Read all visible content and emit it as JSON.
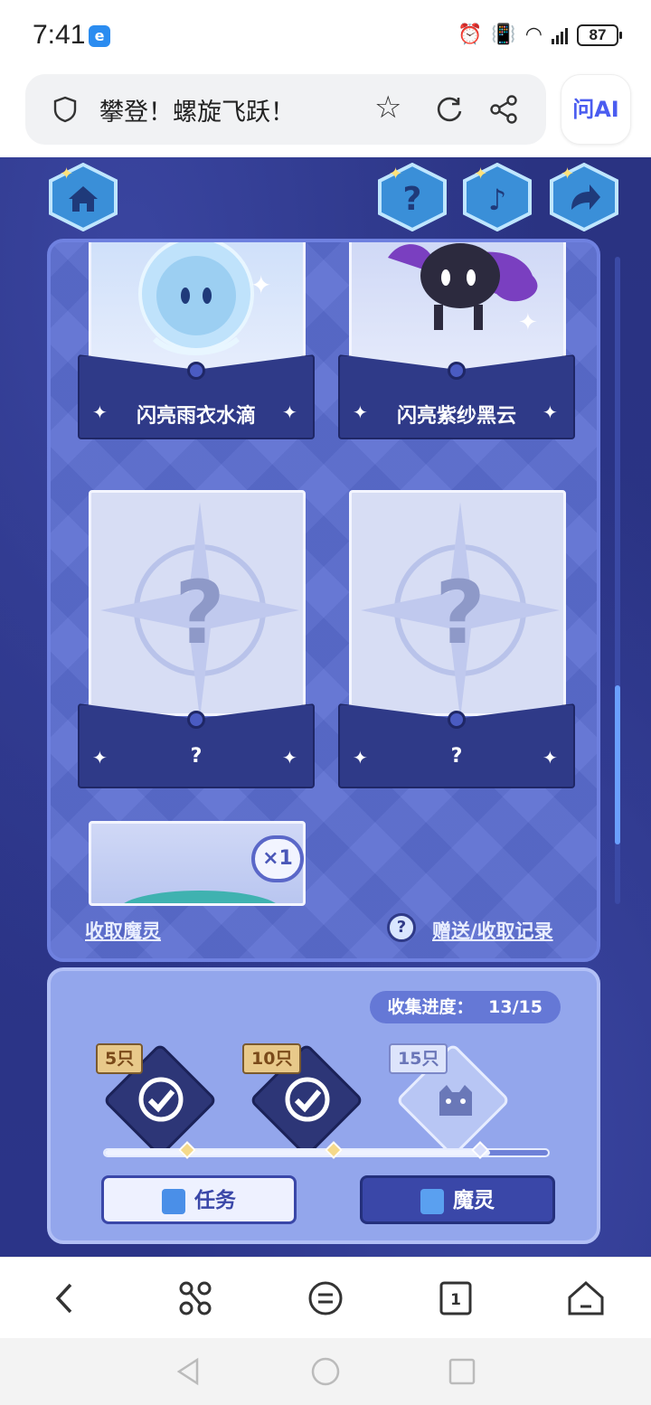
{
  "status_bar": {
    "time": "7:41",
    "battery": "87"
  },
  "browser": {
    "page_title": "攀登！螺旋飞跃！",
    "ai_button_label": "问AI"
  },
  "game": {
    "cards": [
      {
        "name": "闪亮雨衣水滴",
        "locked": false
      },
      {
        "name": "闪亮紫纱黑云",
        "locked": false
      },
      {
        "name": "?",
        "locked": true
      },
      {
        "name": "?",
        "locked": true
      }
    ],
    "partial_card_badge": "×1",
    "collect_link": "收取魔灵",
    "record_link": "赠送/收取记录",
    "progress_label": "收集进度：",
    "progress_value": "13/15",
    "milestones": [
      {
        "label": "5只",
        "achieved": true
      },
      {
        "label": "10只",
        "achieved": true
      },
      {
        "label": "15只",
        "achieved": false
      }
    ],
    "progress_fraction": 0.87,
    "task_button": "任务",
    "spirit_button": "魔灵"
  },
  "colors": {
    "panel": "#5b6dd0",
    "card_base": "#2f3a88",
    "accent": "#3a47a8"
  }
}
